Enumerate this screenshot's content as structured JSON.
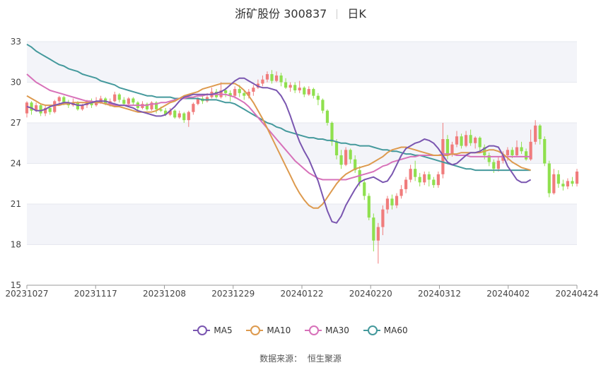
{
  "header": {
    "title": "浙矿股份 300837",
    "period": "日K"
  },
  "source": {
    "label": "数据来源：",
    "name": "恒生聚源"
  },
  "colors": {
    "up": "#f07c7c",
    "down": "#8fe04e",
    "ma5": "#7a56b0",
    "ma10": "#dd9a4e",
    "ma30": "#d771b9",
    "ma60": "#44999c",
    "band": "#f3f4f9"
  },
  "chart_data": {
    "type": "candlestick",
    "title": "浙矿股份 300837",
    "y_ticks": [
      15,
      18,
      21,
      24,
      27,
      30,
      33
    ],
    "ylim": [
      15,
      33
    ],
    "x_tick_labels": [
      "20231027",
      "20231117",
      "20231208",
      "20231229",
      "20240122",
      "20240220",
      "20240312",
      "20240402",
      "20240424"
    ],
    "legend": [
      "MA5",
      "MA10",
      "MA30",
      "MA60"
    ],
    "candles": [
      {
        "o": 27.7,
        "c": 28.5,
        "h": 28.6,
        "l": 27.4
      },
      {
        "o": 28.5,
        "c": 27.9,
        "h": 28.6,
        "l": 27.6
      },
      {
        "o": 27.9,
        "c": 28.3,
        "h": 28.5,
        "l": 27.8
      },
      {
        "o": 28.3,
        "c": 27.7,
        "h": 28.4,
        "l": 27.5
      },
      {
        "o": 27.7,
        "c": 28.1,
        "h": 28.3,
        "l": 27.5
      },
      {
        "o": 28.1,
        "c": 27.8,
        "h": 28.3,
        "l": 27.6
      },
      {
        "o": 27.8,
        "c": 28.6,
        "h": 28.7,
        "l": 27.7
      },
      {
        "o": 28.6,
        "c": 28.9,
        "h": 29.0,
        "l": 28.4
      },
      {
        "o": 28.9,
        "c": 28.5,
        "h": 29.0,
        "l": 28.3
      },
      {
        "o": 28.5,
        "c": 28.3,
        "h": 28.7,
        "l": 28.1
      },
      {
        "o": 28.3,
        "c": 28.5,
        "h": 28.8,
        "l": 28.2
      },
      {
        "o": 28.5,
        "c": 28.0,
        "h": 28.6,
        "l": 27.9
      },
      {
        "o": 28.0,
        "c": 28.3,
        "h": 28.4,
        "l": 27.9
      },
      {
        "o": 28.3,
        "c": 28.6,
        "h": 28.7,
        "l": 28.1
      },
      {
        "o": 28.6,
        "c": 28.3,
        "h": 28.8,
        "l": 28.1
      },
      {
        "o": 28.3,
        "c": 28.5,
        "h": 28.9,
        "l": 28.2
      },
      {
        "o": 28.5,
        "c": 28.8,
        "h": 29.0,
        "l": 28.4
      },
      {
        "o": 28.8,
        "c": 28.4,
        "h": 28.9,
        "l": 28.3
      },
      {
        "o": 28.4,
        "c": 28.6,
        "h": 28.8,
        "l": 28.2
      },
      {
        "o": 28.6,
        "c": 29.1,
        "h": 29.3,
        "l": 28.5
      },
      {
        "o": 29.1,
        "c": 28.7,
        "h": 29.2,
        "l": 28.5
      },
      {
        "o": 28.7,
        "c": 28.4,
        "h": 28.9,
        "l": 28.3
      },
      {
        "o": 28.4,
        "c": 28.8,
        "h": 28.9,
        "l": 28.3
      },
      {
        "o": 28.8,
        "c": 28.5,
        "h": 28.9,
        "l": 28.3
      },
      {
        "o": 28.5,
        "c": 28.1,
        "h": 28.6,
        "l": 27.9
      },
      {
        "o": 28.1,
        "c": 28.4,
        "h": 28.6,
        "l": 28.0
      },
      {
        "o": 28.4,
        "c": 28.0,
        "h": 28.5,
        "l": 27.9
      },
      {
        "o": 28.0,
        "c": 28.5,
        "h": 28.6,
        "l": 27.9
      },
      {
        "o": 28.5,
        "c": 28.0,
        "h": 28.6,
        "l": 27.7
      },
      {
        "o": 28.0,
        "c": 27.9,
        "h": 28.2,
        "l": 27.8
      },
      {
        "o": 27.9,
        "c": 27.6,
        "h": 28.1,
        "l": 27.5
      },
      {
        "o": 27.6,
        "c": 27.9,
        "h": 28.1,
        "l": 27.5
      },
      {
        "o": 27.9,
        "c": 27.4,
        "h": 28.0,
        "l": 27.3
      },
      {
        "o": 27.4,
        "c": 27.7,
        "h": 27.9,
        "l": 27.3
      },
      {
        "o": 27.7,
        "c": 27.2,
        "h": 27.8,
        "l": 27.0
      },
      {
        "o": 27.2,
        "c": 27.8,
        "h": 27.9,
        "l": 26.7
      },
      {
        "o": 27.8,
        "c": 28.4,
        "h": 28.5,
        "l": 27.6
      },
      {
        "o": 28.4,
        "c": 28.8,
        "h": 28.9,
        "l": 28.3
      },
      {
        "o": 28.8,
        "c": 28.6,
        "h": 29.1,
        "l": 28.4
      },
      {
        "o": 28.6,
        "c": 28.9,
        "h": 29.2,
        "l": 28.5
      },
      {
        "o": 28.9,
        "c": 29.3,
        "h": 29.6,
        "l": 28.8
      },
      {
        "o": 29.3,
        "c": 28.9,
        "h": 29.5,
        "l": 28.8
      },
      {
        "o": 28.9,
        "c": 29.4,
        "h": 30.0,
        "l": 28.8
      },
      {
        "o": 29.4,
        "c": 29.2,
        "h": 29.6,
        "l": 28.9
      },
      {
        "o": 29.2,
        "c": 29.0,
        "h": 29.4,
        "l": 28.6
      },
      {
        "o": 29.0,
        "c": 29.5,
        "h": 29.7,
        "l": 28.8
      },
      {
        "o": 29.5,
        "c": 29.2,
        "h": 29.8,
        "l": 28.9
      },
      {
        "o": 29.2,
        "c": 29.0,
        "h": 29.4,
        "l": 28.7
      },
      {
        "o": 29.0,
        "c": 29.3,
        "h": 29.5,
        "l": 28.8
      },
      {
        "o": 29.3,
        "c": 29.6,
        "h": 29.8,
        "l": 29.0
      },
      {
        "o": 29.6,
        "c": 29.9,
        "h": 30.2,
        "l": 29.5
      },
      {
        "o": 29.9,
        "c": 30.2,
        "h": 30.5,
        "l": 29.7
      },
      {
        "o": 30.2,
        "c": 30.6,
        "h": 30.8,
        "l": 30.0
      },
      {
        "o": 30.6,
        "c": 30.1,
        "h": 30.9,
        "l": 29.9
      },
      {
        "o": 30.1,
        "c": 30.5,
        "h": 30.8,
        "l": 30.0
      },
      {
        "o": 30.5,
        "c": 30.0,
        "h": 30.7,
        "l": 29.7
      },
      {
        "o": 30.0,
        "c": 29.6,
        "h": 30.3,
        "l": 29.5
      },
      {
        "o": 29.6,
        "c": 29.8,
        "h": 30.0,
        "l": 29.3
      },
      {
        "o": 29.8,
        "c": 29.4,
        "h": 30.0,
        "l": 29.2
      },
      {
        "o": 29.4,
        "c": 29.6,
        "h": 30.1,
        "l": 29.2
      },
      {
        "o": 29.6,
        "c": 29.1,
        "h": 29.7,
        "l": 28.9
      },
      {
        "o": 29.1,
        "c": 29.5,
        "h": 29.7,
        "l": 29.0
      },
      {
        "o": 29.5,
        "c": 29.0,
        "h": 29.6,
        "l": 28.8
      },
      {
        "o": 29.0,
        "c": 28.7,
        "h": 29.2,
        "l": 28.3
      },
      {
        "o": 28.7,
        "c": 27.9,
        "h": 28.8,
        "l": 27.7
      },
      {
        "o": 27.9,
        "c": 27.0,
        "h": 28.0,
        "l": 26.8
      },
      {
        "o": 27.0,
        "c": 25.6,
        "h": 27.1,
        "l": 25.3
      },
      {
        "o": 25.6,
        "c": 24.6,
        "h": 25.8,
        "l": 24.3
      },
      {
        "o": 24.6,
        "c": 23.9,
        "h": 25.0,
        "l": 23.6
      },
      {
        "o": 23.9,
        "c": 25.0,
        "h": 25.2,
        "l": 23.8
      },
      {
        "o": 25.0,
        "c": 24.3,
        "h": 25.1,
        "l": 24.0
      },
      {
        "o": 24.3,
        "c": 23.5,
        "h": 24.6,
        "l": 23.3
      },
      {
        "o": 23.5,
        "c": 22.6,
        "h": 23.8,
        "l": 22.3
      },
      {
        "o": 22.6,
        "c": 21.6,
        "h": 22.8,
        "l": 21.3
      },
      {
        "o": 21.6,
        "c": 20.0,
        "h": 21.8,
        "l": 19.8
      },
      {
        "o": 20.0,
        "c": 18.3,
        "h": 20.3,
        "l": 17.5
      },
      {
        "o": 18.3,
        "c": 19.3,
        "h": 19.6,
        "l": 16.6
      },
      {
        "o": 19.3,
        "c": 20.6,
        "h": 20.9,
        "l": 18.7
      },
      {
        "o": 20.6,
        "c": 21.4,
        "h": 21.6,
        "l": 20.3
      },
      {
        "o": 21.4,
        "c": 20.9,
        "h": 21.7,
        "l": 20.6
      },
      {
        "o": 20.9,
        "c": 21.6,
        "h": 21.8,
        "l": 20.7
      },
      {
        "o": 21.6,
        "c": 22.1,
        "h": 22.4,
        "l": 21.4
      },
      {
        "o": 22.1,
        "c": 22.8,
        "h": 23.0,
        "l": 21.8
      },
      {
        "o": 22.8,
        "c": 23.6,
        "h": 23.9,
        "l": 22.6
      },
      {
        "o": 23.6,
        "c": 23.0,
        "h": 24.2,
        "l": 22.7
      },
      {
        "o": 23.0,
        "c": 22.6,
        "h": 23.3,
        "l": 22.3
      },
      {
        "o": 22.6,
        "c": 23.2,
        "h": 23.4,
        "l": 22.4
      },
      {
        "o": 23.2,
        "c": 22.8,
        "h": 23.4,
        "l": 22.3
      },
      {
        "o": 22.8,
        "c": 22.4,
        "h": 23.0,
        "l": 22.2
      },
      {
        "o": 22.4,
        "c": 23.2,
        "h": 23.4,
        "l": 22.2
      },
      {
        "o": 23.2,
        "c": 25.8,
        "h": 27.0,
        "l": 22.9
      },
      {
        "o": 25.8,
        "c": 24.7,
        "h": 26.1,
        "l": 24.3
      },
      {
        "o": 24.7,
        "c": 25.4,
        "h": 25.6,
        "l": 24.5
      },
      {
        "o": 25.4,
        "c": 26.0,
        "h": 26.4,
        "l": 25.2
      },
      {
        "o": 26.0,
        "c": 25.3,
        "h": 26.2,
        "l": 25.1
      },
      {
        "o": 25.3,
        "c": 26.1,
        "h": 26.4,
        "l": 25.2
      },
      {
        "o": 26.1,
        "c": 25.5,
        "h": 26.5,
        "l": 25.3
      },
      {
        "o": 25.5,
        "c": 25.9,
        "h": 26.0,
        "l": 25.1
      },
      {
        "o": 25.9,
        "c": 25.2,
        "h": 26.0,
        "l": 24.9
      },
      {
        "o": 25.2,
        "c": 24.6,
        "h": 25.4,
        "l": 24.3
      },
      {
        "o": 24.6,
        "c": 24.1,
        "h": 24.8,
        "l": 23.8
      },
      {
        "o": 24.1,
        "c": 23.6,
        "h": 24.3,
        "l": 23.3
      },
      {
        "o": 23.6,
        "c": 24.2,
        "h": 24.5,
        "l": 23.4
      },
      {
        "o": 24.2,
        "c": 24.6,
        "h": 24.9,
        "l": 24.0
      },
      {
        "o": 24.6,
        "c": 25.0,
        "h": 25.2,
        "l": 24.2
      },
      {
        "o": 25.0,
        "c": 24.6,
        "h": 25.2,
        "l": 24.4
      },
      {
        "o": 24.6,
        "c": 25.2,
        "h": 25.7,
        "l": 24.5
      },
      {
        "o": 25.2,
        "c": 24.9,
        "h": 25.6,
        "l": 24.7
      },
      {
        "o": 24.9,
        "c": 24.3,
        "h": 25.1,
        "l": 24.2
      },
      {
        "o": 24.3,
        "c": 25.6,
        "h": 26.5,
        "l": 24.2
      },
      {
        "o": 25.6,
        "c": 26.8,
        "h": 27.2,
        "l": 25.4
      },
      {
        "o": 26.8,
        "c": 25.8,
        "h": 26.9,
        "l": 25.4
      },
      {
        "o": 25.8,
        "c": 24.0,
        "h": 26.0,
        "l": 23.8
      },
      {
        "o": 24.0,
        "c": 21.8,
        "h": 24.2,
        "l": 21.5
      },
      {
        "o": 21.8,
        "c": 23.2,
        "h": 23.6,
        "l": 21.7
      },
      {
        "o": 23.2,
        "c": 22.5,
        "h": 23.5,
        "l": 22.2
      },
      {
        "o": 22.5,
        "c": 22.3,
        "h": 22.8,
        "l": 22.0
      },
      {
        "o": 22.3,
        "c": 22.7,
        "h": 22.9,
        "l": 22.1
      },
      {
        "o": 22.7,
        "c": 22.5,
        "h": 23.0,
        "l": 22.3
      },
      {
        "o": 22.5,
        "c": 23.4,
        "h": 23.6,
        "l": 22.3
      }
    ],
    "ma5": [
      28.2,
      28.1,
      27.9,
      27.9,
      28.0,
      28.2,
      28.3,
      28.4,
      28.5,
      28.5,
      28.4,
      28.3,
      28.3,
      28.4,
      28.5,
      28.6,
      28.6,
      28.6,
      28.5,
      28.4,
      28.3,
      28.3,
      28.2,
      28.1,
      27.9,
      27.8,
      27.7,
      27.6,
      27.5,
      27.5,
      27.6,
      27.9,
      28.2,
      28.6,
      28.9,
      29.0,
      29.1,
      29.1,
      29.1,
      29.1,
      29.1,
      29.2,
      29.3,
      29.5,
      29.8,
      30.1,
      30.3,
      30.3,
      30.1,
      29.9,
      29.7,
      29.6,
      29.6,
      29.5,
      29.4,
      29.0,
      28.4,
      27.5,
      26.5,
      25.6,
      24.9,
      24.3,
      23.5,
      22.7,
      21.6,
      20.5,
      19.7,
      19.6,
      20.1,
      20.9,
      21.5,
      22.1,
      22.6,
      22.8,
      22.9,
      23.0,
      22.8,
      22.6,
      22.7,
      23.2,
      23.9,
      24.6,
      25.1,
      25.3,
      25.5,
      25.6,
      25.8,
      25.7,
      25.5,
      25.1,
      24.6,
      24.1,
      23.9,
      24.0,
      24.3,
      24.6,
      24.8,
      24.8,
      24.9,
      25.1,
      25.3,
      25.3,
      25.2,
      24.6,
      23.8,
      23.3,
      22.8,
      22.6,
      22.6,
      22.8
    ],
    "ma10": [
      29.0,
      28.8,
      28.6,
      28.4,
      28.3,
      28.3,
      28.3,
      28.3,
      28.4,
      28.4,
      28.5,
      28.5,
      28.5,
      28.5,
      28.5,
      28.5,
      28.5,
      28.4,
      28.3,
      28.2,
      28.2,
      28.1,
      28.0,
      27.9,
      27.8,
      27.8,
      27.8,
      27.8,
      27.9,
      28.1,
      28.3,
      28.5,
      28.6,
      28.8,
      29.0,
      29.1,
      29.2,
      29.3,
      29.5,
      29.6,
      29.7,
      29.8,
      29.9,
      29.9,
      29.9,
      29.9,
      29.7,
      29.4,
      29.0,
      28.5,
      27.9,
      27.3,
      26.6,
      25.9,
      25.2,
      24.5,
      23.8,
      23.1,
      22.4,
      21.8,
      21.3,
      20.9,
      20.7,
      20.7,
      21.0,
      21.5,
      22.0,
      22.5,
      22.9,
      23.2,
      23.4,
      23.6,
      23.7,
      23.8,
      23.9,
      24.1,
      24.3,
      24.5,
      24.8,
      25.0,
      25.1,
      25.2,
      25.2,
      25.1,
      25.0,
      24.9,
      24.8,
      24.7,
      24.6,
      24.6,
      24.6,
      24.6,
      24.7,
      24.7,
      24.8,
      24.8,
      24.8,
      24.8,
      24.8,
      24.9,
      25.0,
      25.0,
      24.9,
      24.7,
      24.4,
      24.1,
      23.9,
      23.7,
      23.6,
      23.5
    ],
    "ma30": [
      30.6,
      30.3,
      30.0,
      29.8,
      29.6,
      29.4,
      29.3,
      29.2,
      29.1,
      29.0,
      28.9,
      28.8,
      28.7,
      28.6,
      28.6,
      28.5,
      28.5,
      28.4,
      28.4,
      28.3,
      28.3,
      28.3,
      28.3,
      28.3,
      28.3,
      28.3,
      28.3,
      28.4,
      28.4,
      28.5,
      28.5,
      28.6,
      28.7,
      28.8,
      28.8,
      28.9,
      28.9,
      29.0,
      29.0,
      29.1,
      29.1,
      29.1,
      29.1,
      29.1,
      29.0,
      28.9,
      28.7,
      28.5,
      28.2,
      27.8,
      27.4,
      27.0,
      26.6,
      26.2,
      25.8,
      25.4,
      25.0,
      24.6,
      24.2,
      23.9,
      23.6,
      23.3,
      23.1,
      22.9,
      22.8,
      22.8,
      22.8,
      22.8,
      22.8,
      22.8,
      22.9,
      23.0,
      23.1,
      23.2,
      23.3,
      23.4,
      23.6,
      23.8,
      23.9,
      24.1,
      24.2,
      24.3,
      24.4,
      24.5,
      24.5,
      24.6,
      24.6,
      24.6,
      24.6,
      24.6,
      24.7,
      24.7,
      24.7,
      24.6,
      24.6,
      24.6,
      24.5,
      24.5,
      24.5,
      24.5,
      24.5,
      24.5,
      24.5,
      24.5,
      24.5,
      24.5,
      24.5,
      24.5,
      24.5,
      24.5
    ],
    "ma60": [
      32.8,
      32.6,
      32.3,
      32.1,
      31.9,
      31.7,
      31.5,
      31.3,
      31.2,
      31.0,
      30.9,
      30.8,
      30.6,
      30.5,
      30.4,
      30.3,
      30.1,
      30.0,
      29.9,
      29.8,
      29.6,
      29.5,
      29.4,
      29.3,
      29.2,
      29.1,
      29.0,
      29.0,
      28.9,
      28.9,
      28.9,
      28.9,
      28.8,
      28.8,
      28.8,
      28.8,
      28.8,
      28.8,
      28.7,
      28.7,
      28.7,
      28.7,
      28.6,
      28.5,
      28.5,
      28.4,
      28.2,
      28.0,
      27.8,
      27.6,
      27.4,
      27.2,
      27.0,
      26.9,
      26.7,
      26.6,
      26.4,
      26.3,
      26.2,
      26.1,
      26.0,
      25.9,
      25.9,
      25.8,
      25.8,
      25.7,
      25.7,
      25.6,
      25.5,
      25.5,
      25.4,
      25.4,
      25.3,
      25.3,
      25.3,
      25.2,
      25.1,
      25.0,
      25.0,
      24.9,
      24.9,
      24.8,
      24.7,
      24.7,
      24.6,
      24.6,
      24.5,
      24.4,
      24.3,
      24.2,
      24.1,
      24.0,
      23.9,
      23.8,
      23.7,
      23.6,
      23.6,
      23.5,
      23.5,
      23.5,
      23.5,
      23.5,
      23.5,
      23.5,
      23.5,
      23.5,
      23.5,
      23.5,
      23.5,
      23.5
    ]
  }
}
